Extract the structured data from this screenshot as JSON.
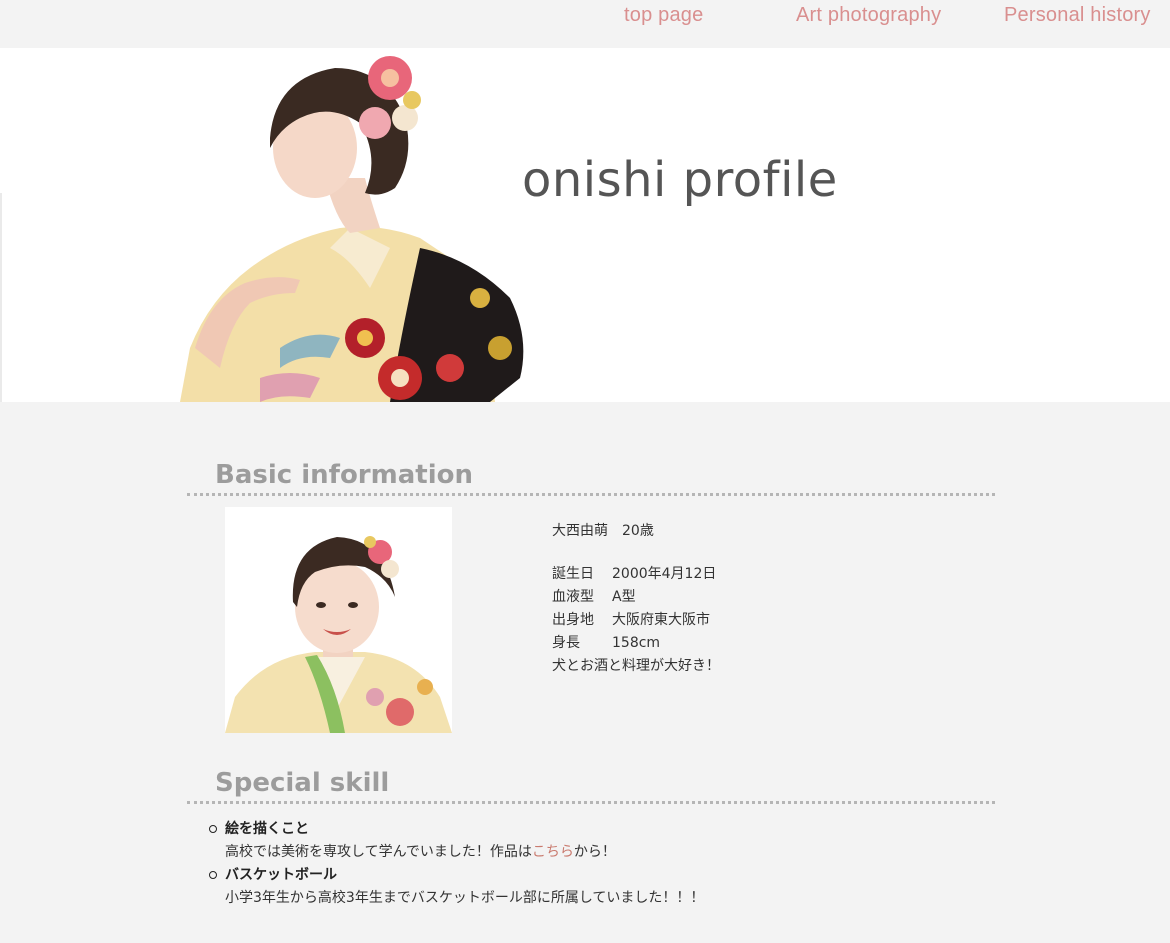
{
  "nav": {
    "items": [
      "top page",
      "Art photography",
      "Personal history"
    ]
  },
  "hero": {
    "title": "onishi profile"
  },
  "basic": {
    "heading": "Basic information",
    "name_line": "大西由萌　20歳",
    "rows": [
      {
        "label": "誕生日",
        "value": "2000年4月12日"
      },
      {
        "label": "血液型",
        "value": "A型"
      },
      {
        "label": "出身地",
        "value": "大阪府東大阪市"
      },
      {
        "label": "身長",
        "value": "158cm"
      }
    ],
    "note": "犬とお酒と料理が大好き！"
  },
  "skills": {
    "heading": "Special skill",
    "items": [
      {
        "title": "絵を描くこと",
        "desc_before": "高校では美術を専攻して学んでいました！作品は",
        "link": "こちら",
        "desc_after": "から！"
      },
      {
        "title": "バスケットボール",
        "desc": "小学3年生から高校3年生までバスケットボール部に所属していました！！！"
      }
    ]
  },
  "colors": {
    "nav_link": "#d98f8f",
    "heading": "#9c9c9c",
    "link": "#c97a6e",
    "background": "#f3f3f3"
  }
}
